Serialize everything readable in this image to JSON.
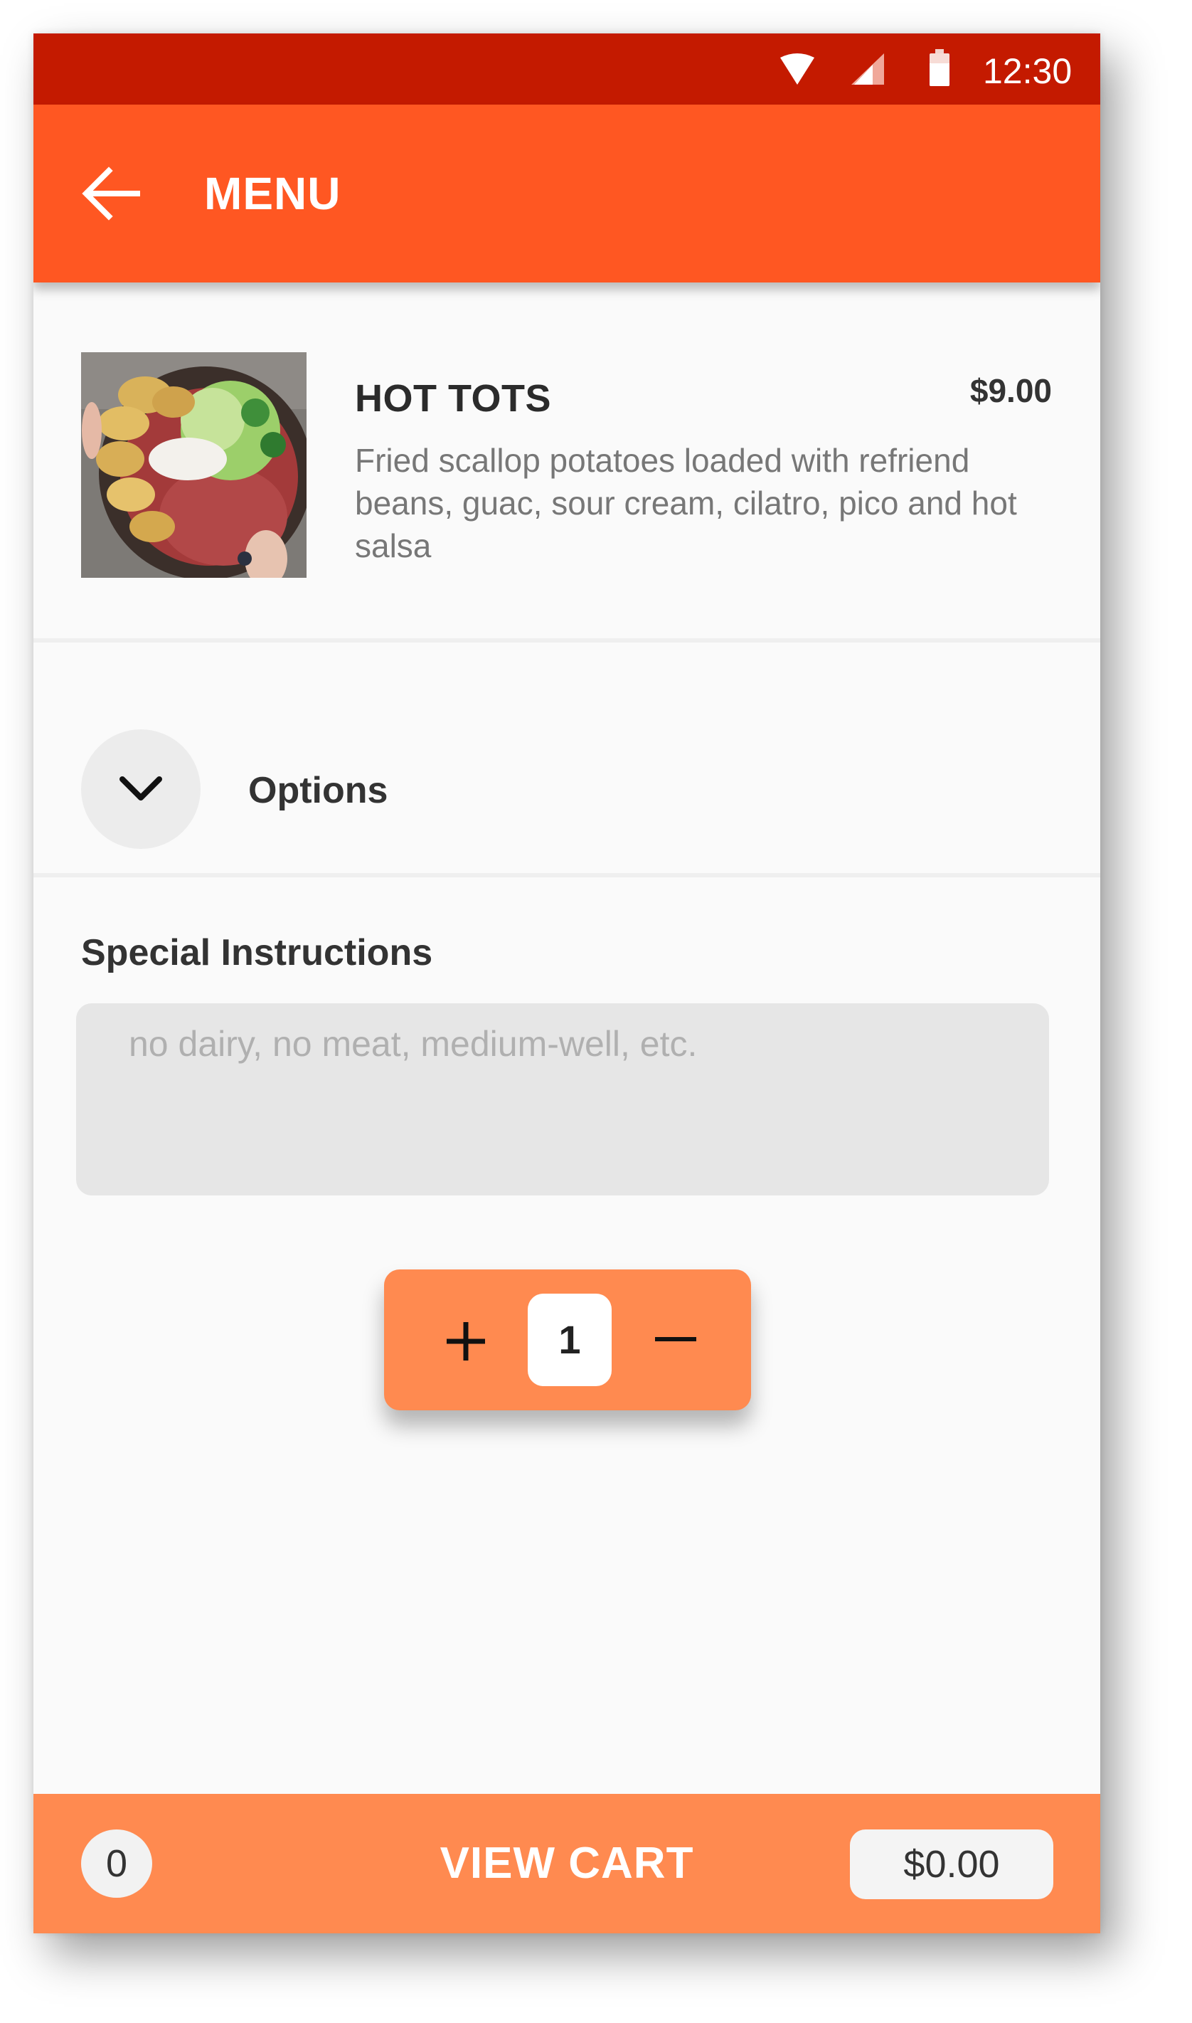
{
  "status_bar": {
    "time": "12:30",
    "icons": [
      "wifi-icon",
      "cellular-signal-icon",
      "battery-icon"
    ]
  },
  "app_bar": {
    "back_icon": "arrow-left-icon",
    "title": "MENU"
  },
  "item": {
    "name": "HOT TOTS",
    "price": "$9.00",
    "description": "Fried scallop potatoes loaded with refriend beans, guac, sour cream, cilatro, pico and hot salsa",
    "image": "food-photo"
  },
  "options": {
    "toggle_icon": "chevron-down-icon",
    "label": "Options"
  },
  "special_instructions": {
    "label": "Special Instructions",
    "value": "",
    "placeholder": "no dairy, no meat, medium-well, etc."
  },
  "quantity": {
    "plus_icon": "plus-icon",
    "value": "1",
    "minus_icon": "minus-icon"
  },
  "cart_bar": {
    "count": "0",
    "label": "VIEW CART",
    "total": "$0.00"
  },
  "colors": {
    "status_bar": "#c41a00",
    "app_bar": "#ff5722",
    "accent": "#ff8a50",
    "background": "#fafafa"
  }
}
